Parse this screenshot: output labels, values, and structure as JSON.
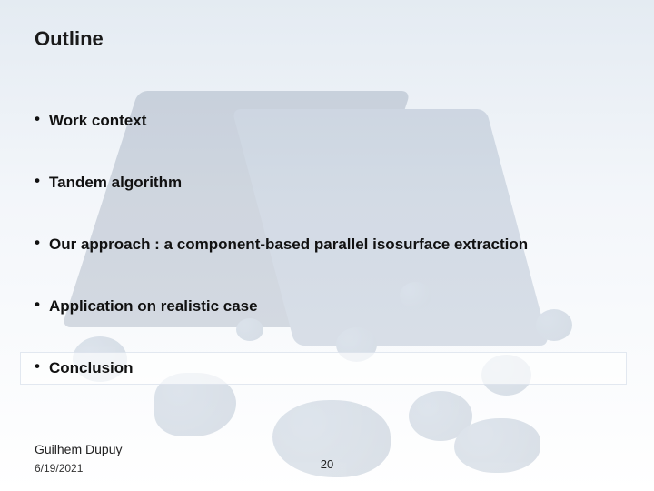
{
  "title": "Outline",
  "items": [
    {
      "label": "Work context",
      "highlight": false
    },
    {
      "label": "Tandem algorithm",
      "highlight": false
    },
    {
      "label": "Our approach : a component-based parallel isosurface extraction",
      "highlight": false
    },
    {
      "label": "Application on realistic case",
      "highlight": false
    },
    {
      "label": "Conclusion",
      "highlight": true
    }
  ],
  "footer": {
    "author": "Guilhem Dupuy",
    "date": "6/19/2021",
    "page": "20"
  }
}
